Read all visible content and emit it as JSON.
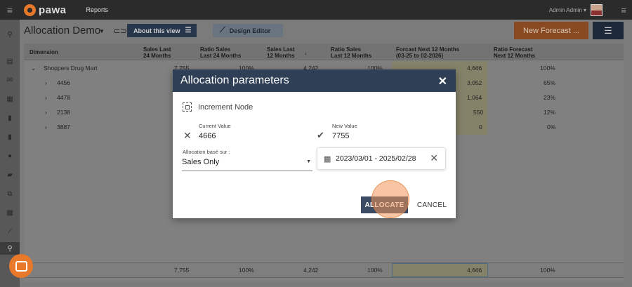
{
  "app": {
    "logo_text": "pawa",
    "nav_reports": "Reports",
    "user_name": "Admin Admin",
    "user_caret": "▾"
  },
  "toolbar": {
    "title": "Allocation Demo",
    "about_label": "About this view",
    "design_label": "Design Editor",
    "new_forecast_label": "New Forecast ...",
    "colors": {
      "about": "#27364a",
      "forecast": "#e8782a",
      "filter": "#1d2938"
    }
  },
  "table": {
    "headers": [
      "Dimension",
      "Sales Last\n24 Months",
      "Ratio Sales\nLast 24 Months",
      "Sales Last\n12 Months",
      "Ratio Sales\nLast 12 Months",
      "Forcast Next 12 Months\n(03-25 to 02-2026)",
      "Ratio Forecast\nNext 12 Months"
    ],
    "sort_indicator": "↓",
    "rows": [
      {
        "dimension": "Shoppers Drug Mart",
        "level": 0,
        "expand": "⌄",
        "s24": "7,755",
        "r24": "100%",
        "s12": "4,242",
        "r12": "100%",
        "f12": "4,666",
        "rf": "100%"
      },
      {
        "dimension": "4456",
        "level": 1,
        "expand": "›",
        "s24": "",
        "r24": "",
        "s12": "",
        "r12": "",
        "f12": "3,052",
        "rf": "65%"
      },
      {
        "dimension": "4478",
        "level": 1,
        "expand": "›",
        "s24": "",
        "r24": "",
        "s12": "",
        "r12": "",
        "f12": "1,064",
        "rf": "23%"
      },
      {
        "dimension": "2138",
        "level": 1,
        "expand": "›",
        "s24": "",
        "r24": "",
        "s12": "",
        "r12": "",
        "f12": "550",
        "rf": "12%"
      },
      {
        "dimension": "3887",
        "level": 1,
        "expand": "›",
        "s24": "",
        "r24": "",
        "s12": "",
        "r12": "",
        "f12": "0",
        "rf": "0%"
      }
    ],
    "footer": {
      "s24": "7,755",
      "r24": "100%",
      "s12": "4,242",
      "r12": "100%",
      "f12": "4,666",
      "rf": "100%"
    }
  },
  "modal": {
    "title": "Allocation parameters",
    "node_label": "Increment Node",
    "current_label": "Current Value",
    "current_value": "4666",
    "new_label": "New Value",
    "new_value": "7755",
    "alloc_label": "Allocation basé sur :",
    "alloc_value": "Sales Only",
    "date_range": "2023/03/01 - 2025/02/28",
    "allocate_label": "ALLOCATE",
    "cancel_label": "CANCEL"
  }
}
